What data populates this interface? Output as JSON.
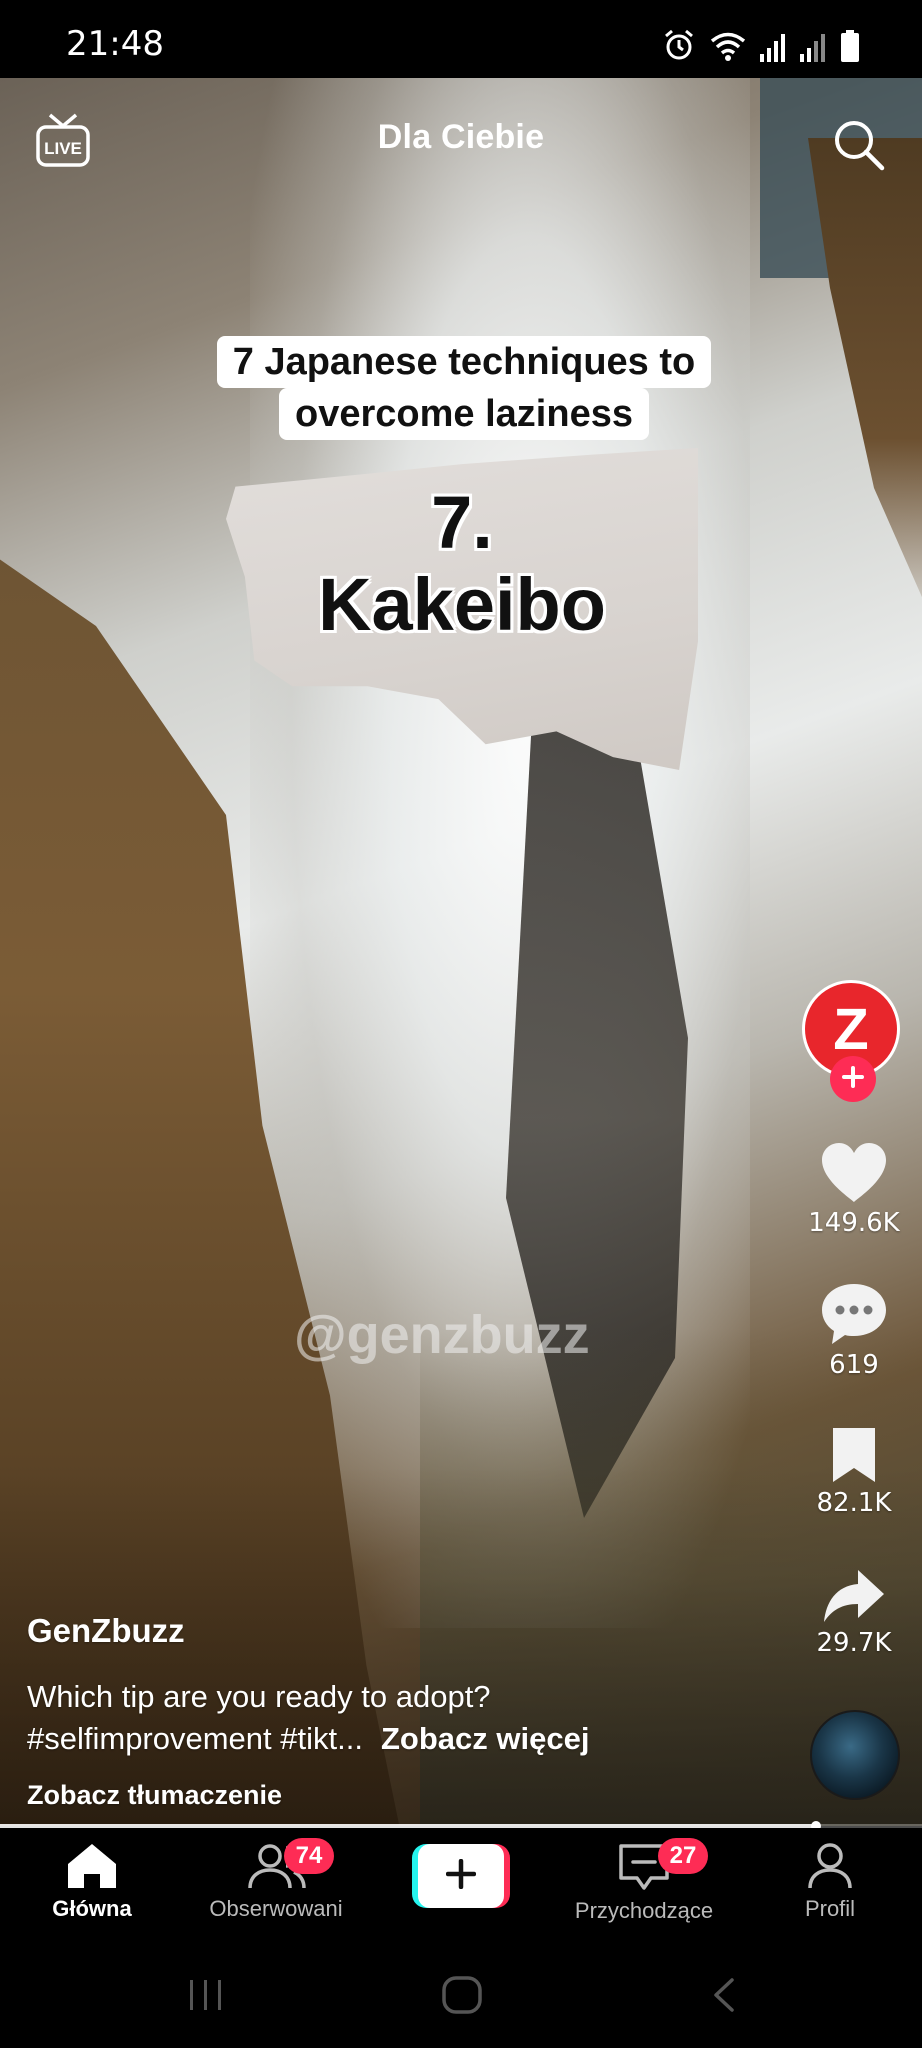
{
  "status_bar": {
    "time": "21:48",
    "icons": [
      "alarm-icon",
      "wifi-icon",
      "signal-icon",
      "signal-icon",
      "battery-icon"
    ]
  },
  "header": {
    "live_icon": "live-icon",
    "live_label": "LIVE",
    "title": "Dla Ciebie",
    "search_icon": "search-icon"
  },
  "video": {
    "caption_line1": "7 Japanese techniques to",
    "caption_line2": "overcome laziness",
    "number": "7.",
    "word": "Kakeibo",
    "watermark": "@genzbuzz",
    "progress": 0.885
  },
  "rail": {
    "avatar_letter": "Z",
    "avatar_color": "#e8262c",
    "follow_icon": "plus-icon",
    "likes": "149.6K",
    "comments": "619",
    "saves": "82.1K",
    "shares": "29.7K"
  },
  "post": {
    "username": "GenZbuzz",
    "description": "Which tip are you ready to adopt?",
    "hashtags": "#selfimprovement #tikt...",
    "see_more": "Zobacz więcej",
    "translate": "Zobacz tłumaczenie"
  },
  "tabbar": {
    "home": "Główna",
    "following": "Obserwowani",
    "following_badge": "74",
    "inbox": "Przychodzące",
    "inbox_badge": "27",
    "profile": "Profil",
    "accent": "#fe2c55",
    "create_left_color": "#25f4ee"
  }
}
